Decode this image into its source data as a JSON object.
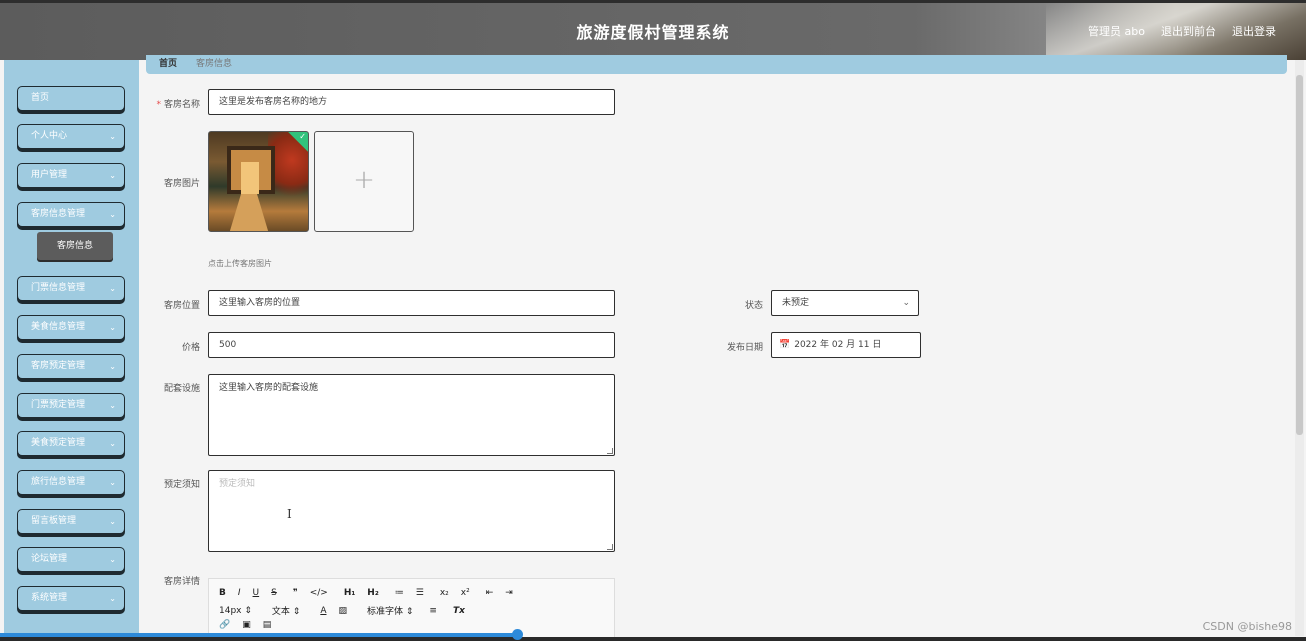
{
  "header": {
    "title": "旅游度假村管理系统",
    "user_label": "管理员 abo",
    "frontend_link": "退出到前台",
    "logout_link": "退出登录"
  },
  "breadcrumb": {
    "home": "首页",
    "current": "客房信息"
  },
  "sidebar": {
    "items": [
      {
        "label": "首页",
        "chevron": ""
      },
      {
        "label": "个人中心",
        "chevron": "⌄"
      },
      {
        "label": "用户管理",
        "chevron": "⌄"
      },
      {
        "label": "客房信息管理",
        "chevron": "⌄"
      },
      {
        "label": "门票信息管理",
        "chevron": "⌄"
      },
      {
        "label": "美食信息管理",
        "chevron": "⌄"
      },
      {
        "label": "客房预定管理",
        "chevron": "⌄"
      },
      {
        "label": "门票预定管理",
        "chevron": "⌄"
      },
      {
        "label": "美食预定管理",
        "chevron": "⌄"
      },
      {
        "label": "旅行信息管理",
        "chevron": "⌄"
      },
      {
        "label": "留言板管理",
        "chevron": "⌄"
      },
      {
        "label": "论坛管理",
        "chevron": "⌄"
      },
      {
        "label": "系统管理",
        "chevron": "⌄"
      }
    ],
    "subitem": "客房信息"
  },
  "form": {
    "room_name": {
      "label": "客房名称",
      "required": "*",
      "value": "这里是发布客房名称的地方"
    },
    "room_image": {
      "label": "客房图片",
      "hint": "点击上传客房图片",
      "upload_icon": "+",
      "success_icon": "✓"
    },
    "location": {
      "label": "客房位置",
      "value": "这里输入客房的位置"
    },
    "status": {
      "label": "状态",
      "value": "未预定",
      "arrow": "⌄"
    },
    "price": {
      "label": "价格",
      "value": "500"
    },
    "publish_date": {
      "label": "发布日期",
      "value": "2022 年 02 月 11 日",
      "icon": "📅"
    },
    "facilities": {
      "label": "配套设施",
      "value": "这里输入客房的配套设施"
    },
    "notice": {
      "label": "预定须知",
      "placeholder": "预定须知"
    },
    "details": {
      "label": "客房详情"
    }
  },
  "editor_toolbar": {
    "row1": [
      "B",
      "I",
      "U",
      "S",
      "❞",
      "</>",
      "H₁",
      "H₂",
      "≔",
      "☰",
      "x₂",
      "x²",
      "⇤",
      "⇥"
    ],
    "row2": [
      "14px ⇕",
      "文本 ⇕",
      "A",
      "▨",
      "标准字体 ⇕",
      "≡",
      "Tx"
    ],
    "row3": [
      "🔗",
      "▣",
      "▤"
    ]
  },
  "watermark": "CSDN @bishe98"
}
